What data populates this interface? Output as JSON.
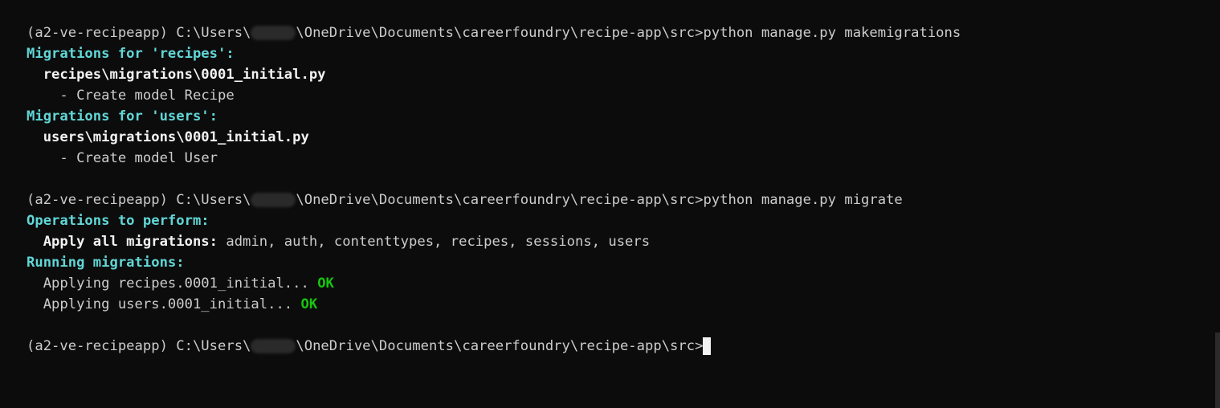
{
  "colors": {
    "background": "#0c0c0c",
    "text": "#cccccc",
    "heading": "#61d6d6",
    "success": "#16c60c"
  },
  "prompt": {
    "env": "(a2-ve-recipeapp) C:\\Users\\",
    "path_suffix": "\\OneDrive\\Documents\\careerfoundry\\recipe-app\\src>"
  },
  "block1": {
    "command": "python manage.py makemigrations",
    "recipes_heading": "Migrations for 'recipes':",
    "recipes_file": "recipes\\migrations\\0001_initial.py",
    "recipes_op": "- Create model Recipe",
    "users_heading": "Migrations for 'users':",
    "users_file": "users\\migrations\\0001_initial.py",
    "users_op": "- Create model User"
  },
  "block2": {
    "command": "python manage.py migrate",
    "ops_heading": "Operations to perform:",
    "apply_label": "Apply all migrations:",
    "apply_apps": " admin, auth, contenttypes, recipes, sessions, users",
    "running_heading": "Running migrations:",
    "apply1_text": "Applying recipes.0001_initial...",
    "apply1_status": "OK",
    "apply2_text": "Applying users.0001_initial...",
    "apply2_status": "OK"
  }
}
